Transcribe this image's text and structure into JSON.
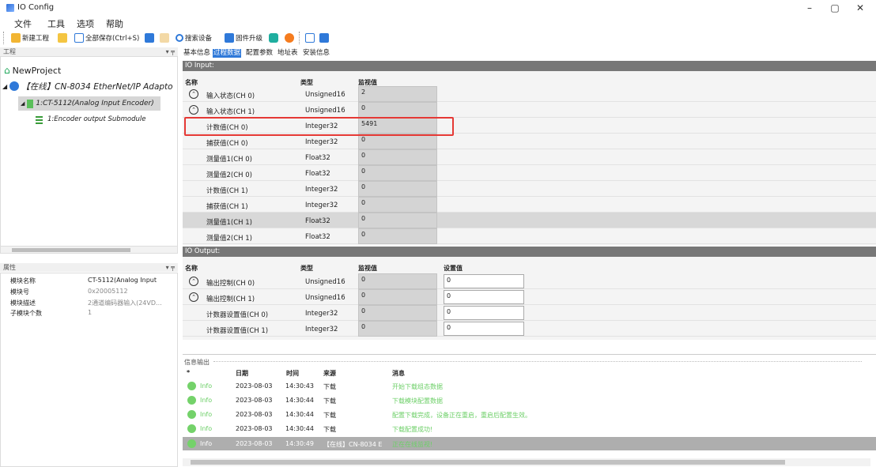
{
  "window": {
    "title": "IO Config",
    "min": "–",
    "max": "▢",
    "close": "✕"
  },
  "menu": [
    "文件",
    "工具",
    "选项",
    "帮助"
  ],
  "toolbar": {
    "new_project": "新建工程",
    "save_all": "全部保存(Ctrl+S)",
    "search_device": "搜索设备",
    "firmware_upgrade": "固件升级"
  },
  "project_panel": {
    "title": "工程",
    "pin": "▾ ╤",
    "tree": [
      {
        "label": "NewProject"
      },
      {
        "label": "【在线】CN-8034 EtherNet/IP Adapto"
      },
      {
        "label": "1:CT-5112(Analog Input Encoder)"
      },
      {
        "label": "1:Encoder output  Submodule"
      }
    ]
  },
  "properties_panel": {
    "title": "属性",
    "rows": [
      {
        "k": "模块名称",
        "v": "CT-5112(Analog Input"
      },
      {
        "k": "模块号",
        "v": "0x20005112"
      },
      {
        "k": "模块描述",
        "v": "2通道编码器输入(24VD..."
      },
      {
        "k": "子模块个数",
        "v": "1"
      }
    ]
  },
  "tabs": [
    "基本信息",
    "过程数据",
    "配置参数",
    "地址表",
    "安装信息"
  ],
  "io_input": {
    "title": "IO Input:",
    "headers": {
      "name": "名称",
      "type": "类型",
      "monitor": "监视值"
    },
    "rows": [
      {
        "name": "输入状态(CH 0)",
        "type": "Unsigned16",
        "value": "2"
      },
      {
        "name": "输入状态(CH 1)",
        "type": "Unsigned16",
        "value": "0"
      },
      {
        "name": "计数值(CH 0)",
        "type": "Integer32",
        "value": "5491"
      },
      {
        "name": "捕获值(CH 0)",
        "type": "Integer32",
        "value": "0"
      },
      {
        "name": "测量值1(CH 0)",
        "type": "Float32",
        "value": "0"
      },
      {
        "name": "测量值2(CH 0)",
        "type": "Float32",
        "value": "0"
      },
      {
        "name": "计数值(CH 1)",
        "type": "Integer32",
        "value": "0"
      },
      {
        "name": "捕获值(CH 1)",
        "type": "Integer32",
        "value": "0"
      },
      {
        "name": "测量值1(CH 1)",
        "type": "Float32",
        "value": "0"
      },
      {
        "name": "测量值2(CH 1)",
        "type": "Float32",
        "value": "0"
      }
    ]
  },
  "io_output": {
    "title": "IO Output:",
    "headers": {
      "name": "名称",
      "type": "类型",
      "monitor": "监视值",
      "set": "设置值"
    },
    "rows": [
      {
        "name": "输出控制(CH 0)",
        "type": "Unsigned16",
        "value": "0",
        "set": "0"
      },
      {
        "name": "输出控制(CH 1)",
        "type": "Unsigned16",
        "value": "0",
        "set": "0"
      },
      {
        "name": "计数器设置值(CH 0)",
        "type": "Integer32",
        "value": "0",
        "set": "0"
      },
      {
        "name": "计数器设置值(CH 1)",
        "type": "Integer32",
        "value": "0",
        "set": "0"
      }
    ]
  },
  "log": {
    "title": "信息输出",
    "headers": {
      "star": "*",
      "date": "日期",
      "time": "时间",
      "source": "来源",
      "message": "消息"
    },
    "rows": [
      {
        "level": "Info",
        "date": "2023-08-03",
        "time": "14:30:43",
        "source": "下载",
        "message": "开始下载组态数据"
      },
      {
        "level": "Info",
        "date": "2023-08-03",
        "time": "14:30:44",
        "source": "下载",
        "message": "下载模块配置数据"
      },
      {
        "level": "Info",
        "date": "2023-08-03",
        "time": "14:30:44",
        "source": "下载",
        "message": "配置下载完成，设备正在重启，重启后配置生效。"
      },
      {
        "level": "Info",
        "date": "2023-08-03",
        "time": "14:30:44",
        "source": "下载",
        "message": "下载配置成功!"
      },
      {
        "level": "Info",
        "date": "2023-08-03",
        "time": "14:30:49",
        "source": "【在线】CN-8034 E",
        "message": "正在在线监视!"
      }
    ]
  },
  "colors": {
    "accent": "#2f79d9",
    "highlight_box": "#e53935",
    "info_green": "#74d26a"
  }
}
